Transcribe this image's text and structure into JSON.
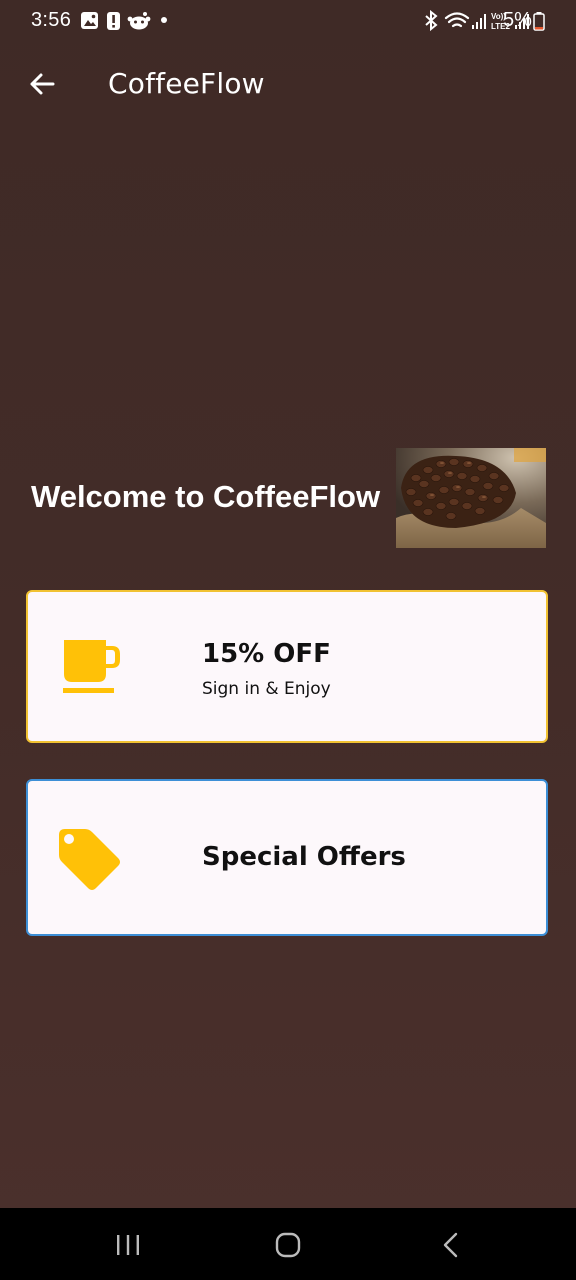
{
  "status_bar": {
    "time": "3:56",
    "battery_percent": "5%",
    "left_icons": [
      "image-icon",
      "alert-icon",
      "reddit-icon",
      "dot-icon"
    ],
    "right_icons": [
      "bluetooth-icon",
      "wifi-icon",
      "signal-icon",
      "volte-icon",
      "signal-icon",
      "battery-icon"
    ],
    "battery_level": 0.05,
    "battery_color": "#e4572e"
  },
  "app_bar": {
    "title": "CoffeeFlow",
    "back_icon": "arrow-left-icon"
  },
  "welcome": {
    "text": "Welcome to CoffeeFlow",
    "image": "coffee-beans-sack"
  },
  "cards": {
    "discount": {
      "title": "15% OFF",
      "subtitle": "Sign in & Enjoy",
      "icon": "coffee-cup-icon",
      "border_color": "#f1c232"
    },
    "offers": {
      "title": "Special Offers",
      "icon": "tag-icon",
      "border_color": "#3d8fd6"
    }
  },
  "colors": {
    "background": "#432c28",
    "card_background": "#fdf8fb",
    "icon_yellow": "#ffc107"
  },
  "nav_bar": {
    "buttons": [
      "recent-apps-icon",
      "home-icon",
      "back-icon"
    ]
  }
}
